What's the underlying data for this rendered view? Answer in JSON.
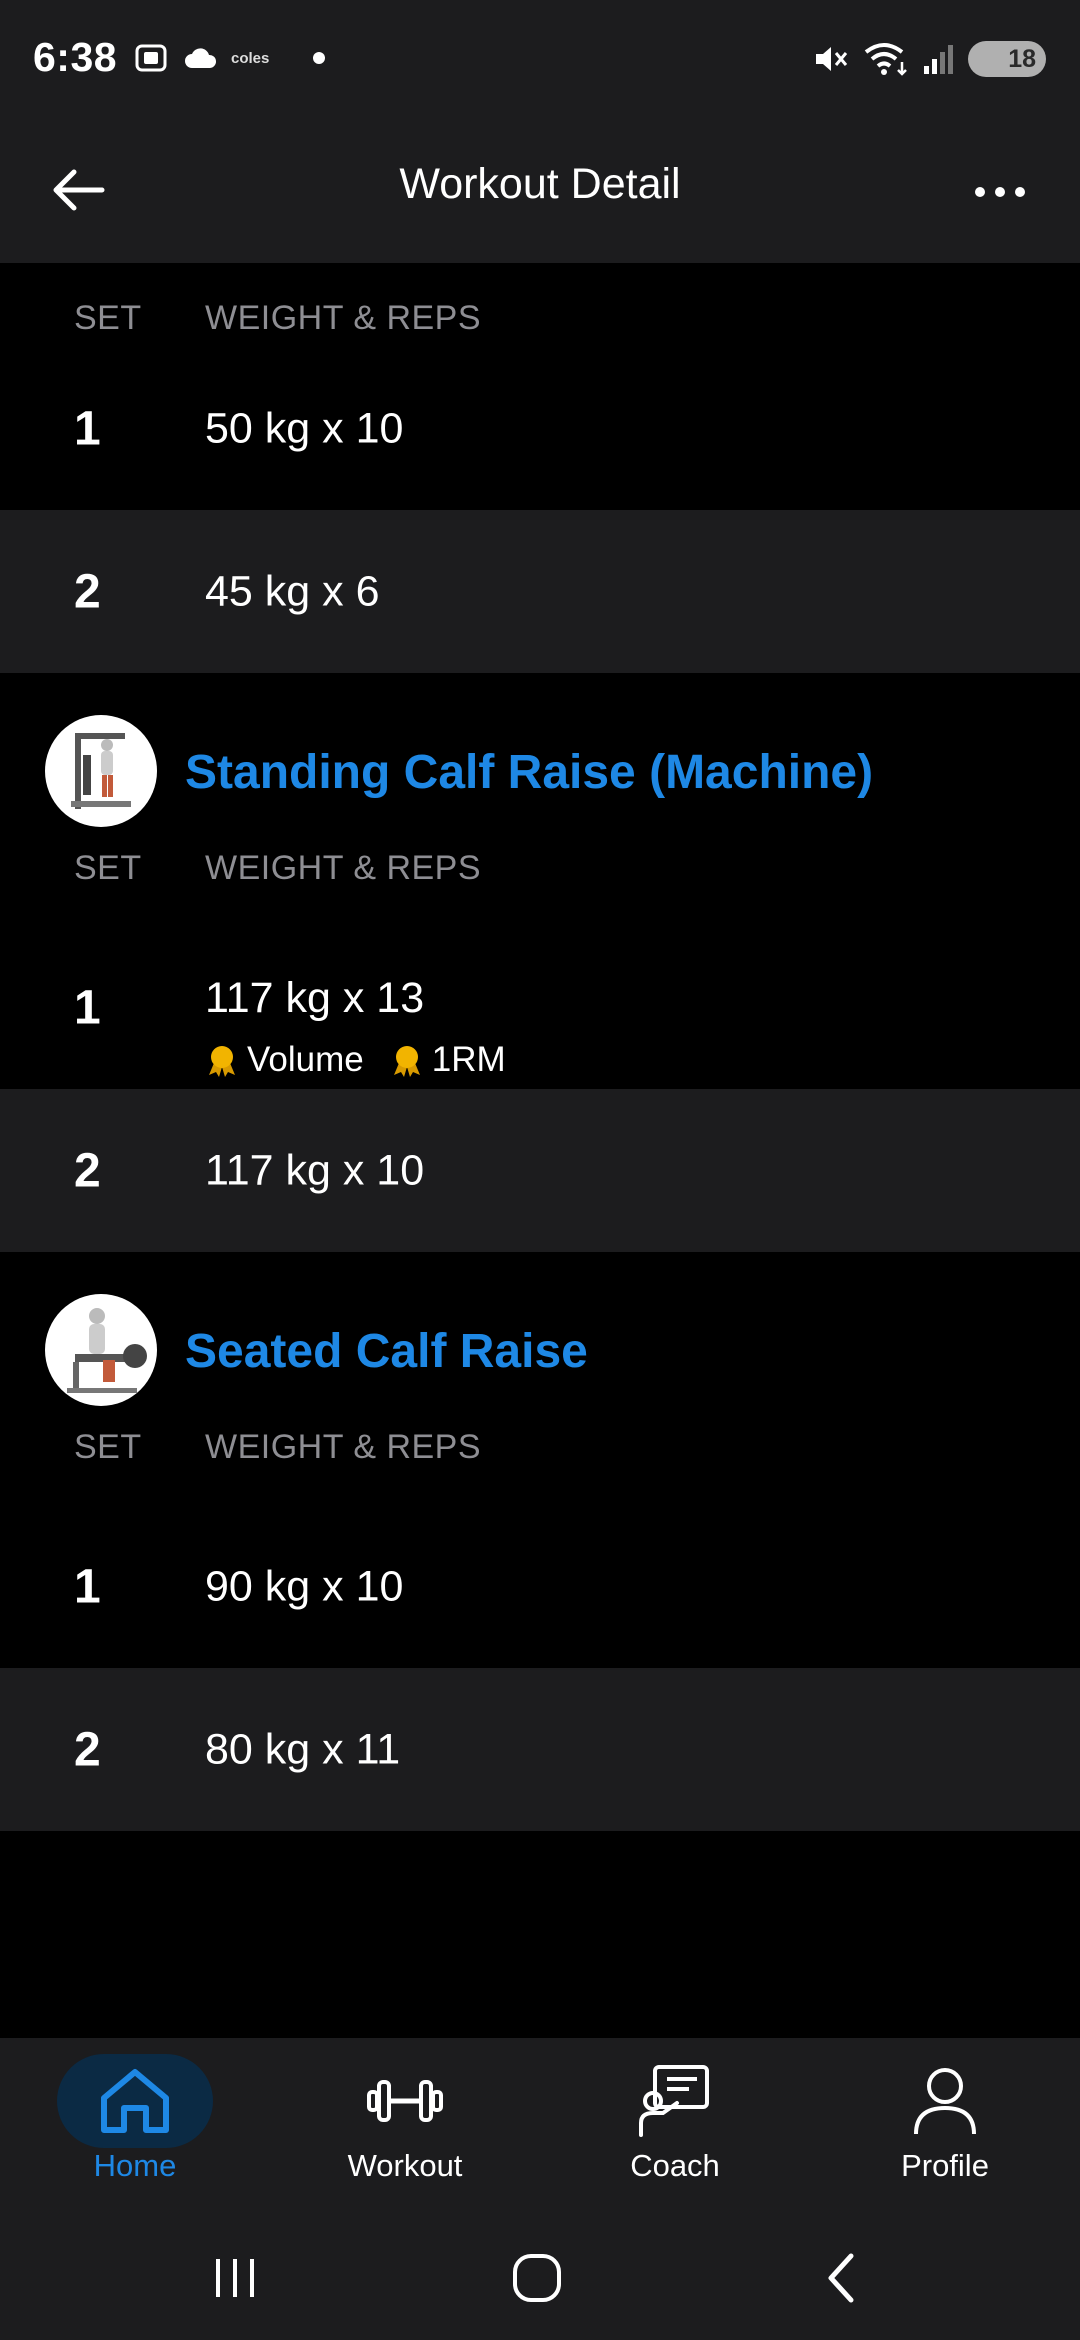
{
  "status_bar": {
    "time": "6:38",
    "carrier_label": "coles",
    "battery": "18"
  },
  "header": {
    "title": "Workout Detail"
  },
  "columns": {
    "set": "SET",
    "weight_reps": "WEIGHT & REPS"
  },
  "exercises": [
    {
      "name": "",
      "sets": [
        {
          "set": "1",
          "value": "50 kg x 10"
        },
        {
          "set": "2",
          "value": "45 kg x 6"
        }
      ]
    },
    {
      "name": "Standing Calf Raise (Machine)",
      "thumbnail_icon": "calf-raise-machine-illustration",
      "sets": [
        {
          "set": "1",
          "value": "117 kg x 13",
          "badges": [
            "Volume",
            "1RM"
          ]
        },
        {
          "set": "2",
          "value": "117 kg x 10"
        }
      ]
    },
    {
      "name": "Seated Calf Raise",
      "thumbnail_icon": "seated-calf-raise-illustration",
      "sets": [
        {
          "set": "1",
          "value": "90 kg x 10"
        },
        {
          "set": "2",
          "value": "80 kg x 11"
        }
      ]
    }
  ],
  "bottom_nav": {
    "items": [
      {
        "label": "Home",
        "icon": "home-icon",
        "active": true
      },
      {
        "label": "Workout",
        "icon": "dumbbell-icon",
        "active": false
      },
      {
        "label": "Coach",
        "icon": "coach-icon",
        "active": false
      },
      {
        "label": "Profile",
        "icon": "profile-icon",
        "active": false
      }
    ]
  },
  "colors": {
    "accent": "#1e88e5",
    "background": "#000000",
    "surface": "#1c1c1e",
    "muted_text": "#8e8e93",
    "medal": "#f2b400"
  }
}
